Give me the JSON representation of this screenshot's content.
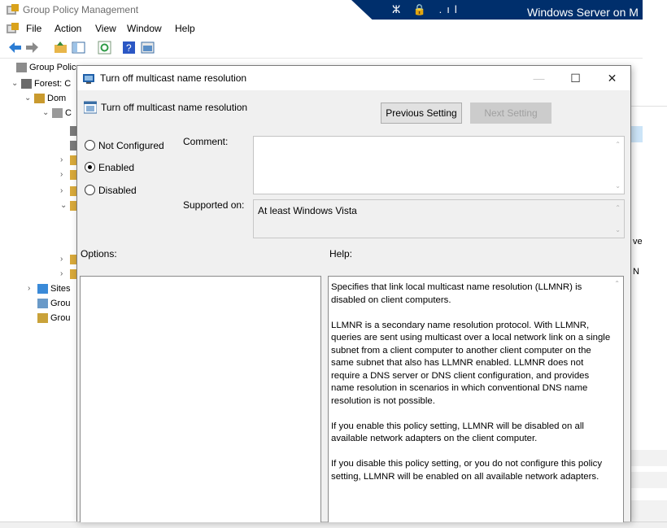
{
  "mmc": {
    "title": "Group Policy Management",
    "menu": [
      "File",
      "Action",
      "View",
      "Window",
      "Help"
    ],
    "tree": [
      {
        "chev": "",
        "label": "Group Polic"
      },
      {
        "chev": "⌄",
        "label": "Forest: C"
      },
      {
        "chev": "⌄",
        "label": "Dom"
      },
      {
        "chev": "⌄",
        "label": "C"
      },
      {
        "chev": "",
        "label": ""
      },
      {
        "chev": "",
        "label": ""
      },
      {
        "chev": "›",
        "label": ""
      },
      {
        "chev": "›",
        "label": ""
      },
      {
        "chev": "›",
        "label": ""
      },
      {
        "chev": "⌄",
        "label": ""
      },
      {
        "chev": "›",
        "label": ""
      },
      {
        "chev": "›",
        "label": ""
      },
      {
        "chev": "›",
        "label": "Sites"
      },
      {
        "chev": "",
        "label": "Grou"
      },
      {
        "chev": "",
        "label": "Grou"
      }
    ],
    "right_fragments": [
      "ve",
      "N"
    ]
  },
  "rdp": {
    "title": "Windows Server on M",
    "icons": "ⵣ 🔒 .ıl"
  },
  "dialog": {
    "title": "Turn off multicast name resolution",
    "policy_name": "Turn off multicast name resolution",
    "buttons": {
      "previous": "Previous Setting",
      "next": "Next Setting",
      "minimize": "—",
      "maximize": "☐",
      "close": "✕"
    },
    "state": {
      "options": [
        "Not Configured",
        "Enabled",
        "Disabled"
      ],
      "selected": "Enabled"
    },
    "comment_label": "Comment:",
    "comment_value": "",
    "supported_on_label": "Supported on:",
    "supported_on_value": "At least Windows Vista",
    "options_label": "Options:",
    "help_label": "Help:",
    "help_paragraphs": [
      "Specifies that link local multicast name resolution (LLMNR) is disabled on client computers.",
      "LLMNR is a secondary name resolution protocol. With LLMNR, queries are sent using multicast over a local network link on a single subnet from a client computer to another client computer on the same subnet that also has LLMNR enabled. LLMNR does not require a DNS server or DNS client configuration, and provides name resolution in scenarios in which conventional DNS name resolution is not possible.",
      "If you enable this policy setting, LLMNR will be disabled on all available network adapters on the client computer.",
      "If you disable this policy setting, or you do not configure this policy setting, LLMNR will be enabled on all available network adapters."
    ]
  },
  "colors": {
    "rdp_bar": "#002f6c",
    "dialog_bg": "#f0f0f0",
    "button_face": "#e1e1e1"
  }
}
